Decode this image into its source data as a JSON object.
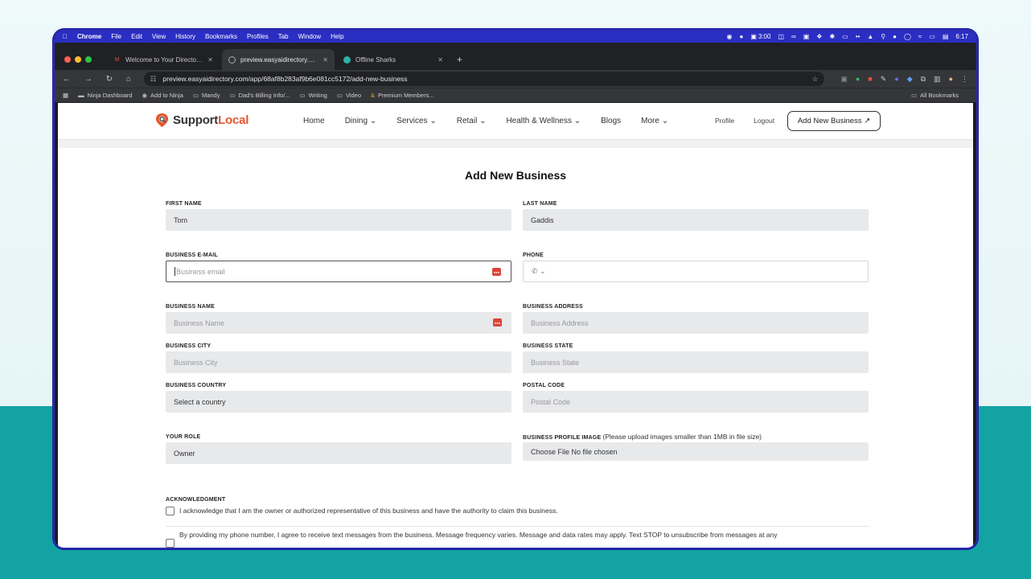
{
  "menubar": {
    "app": "Chrome",
    "items": [
      "File",
      "Edit",
      "View",
      "History",
      "Bookmarks",
      "Profiles",
      "Tab",
      "Window",
      "Help"
    ],
    "clock": "6:17",
    "timer": "3:00"
  },
  "tabs": [
    {
      "title": "Welcome to Your Directory N",
      "icon": "gmail-icon"
    },
    {
      "title": "preview.easyaidirectory.com/",
      "icon": "globe-icon"
    },
    {
      "title": "Offline Sharks",
      "icon": "shark-icon"
    }
  ],
  "toolbar": {
    "url": "preview.easyaidirectory.com/app/68af8b283af9b6e081cc5172/add-new-business"
  },
  "bookmarks": {
    "items": [
      "Ninja Dashboard",
      "Add to Ninja",
      "Mandy",
      "Dad's Billing Info/...",
      "Writing",
      "Video",
      "Premium Members..."
    ],
    "all": "All Bookmarks"
  },
  "site": {
    "logo_main": "Support",
    "logo_accent": "Local",
    "nav": [
      "Home",
      "Dining ⌄",
      "Services ⌄",
      "Retail ⌄",
      "Health & Wellness ⌄",
      "Blogs",
      "More ⌄"
    ],
    "profile": "Profile",
    "logout": "Logout",
    "add_button": "Add New Business ↗"
  },
  "form": {
    "title": "Add New Business",
    "first_name": {
      "label": "FIRST NAME",
      "value": "Tom"
    },
    "last_name": {
      "label": "LAST NAME",
      "value": "Gaddis"
    },
    "email": {
      "label": "BUSINESS E-MAIL",
      "placeholder": "Business email"
    },
    "phone": {
      "label": "PHONE",
      "placeholder": ""
    },
    "business_name": {
      "label": "BUSINESS NAME",
      "placeholder": "Business Name"
    },
    "business_address": {
      "label": "BUSINESS ADDRESS",
      "placeholder": "Business Address"
    },
    "business_city": {
      "label": "BUSINESS CITY",
      "placeholder": "Business City"
    },
    "business_state": {
      "label": "BUSINESS STATE",
      "placeholder": "Business State"
    },
    "business_country": {
      "label": "BUSINESS COUNTRY",
      "value": "Select a country"
    },
    "postal_code": {
      "label": "POSTAL CODE",
      "placeholder": "Postal Code"
    },
    "role": {
      "label": "YOUR ROLE",
      "value": "Owner"
    },
    "profile_image": {
      "label": "BUSINESS PROFILE IMAGE",
      "note": "(Please upload images smaller than 1MB in file size)",
      "value": "Choose File No file chosen"
    },
    "acknowledgment": {
      "label": "ACKNOWLEDGMENT",
      "owner_text": "I acknowledge that I am the owner or authorized representative of this business and have the authority to claim this business.",
      "sms_text": "By providing my phone number, I agree to receive text messages from the business. Message frequency varies. Message and data rates may apply. Text STOP to unsubscribe from messages at any"
    }
  },
  "colors": {
    "menubar": "#2b2ec2",
    "accent": "#e4572e",
    "teal_bg": "#14a3a3"
  }
}
